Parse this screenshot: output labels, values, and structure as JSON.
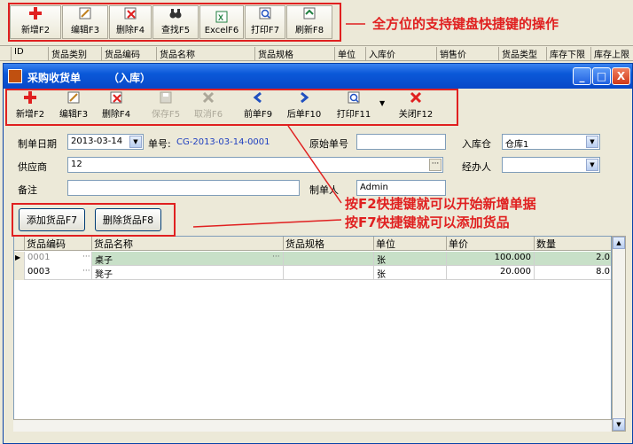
{
  "bg_toolbar": [
    {
      "label": "新增F2",
      "icon": "add-icon"
    },
    {
      "label": "编辑F3",
      "icon": "edit-icon"
    },
    {
      "label": "删除F4",
      "icon": "delete-icon"
    },
    {
      "label": "查找F5",
      "icon": "binoculars-icon"
    },
    {
      "label": "ExcelF6",
      "icon": "excel-icon"
    },
    {
      "label": "打印F7",
      "icon": "print-icon"
    },
    {
      "label": "刷新F8",
      "icon": "refresh-icon"
    }
  ],
  "annotations": {
    "top": "全方位的支持键盘快捷键的操作",
    "line1": "按F2快捷键就可以开始新增单据",
    "line2": "按F7快捷键就可以添加货品"
  },
  "bg_grid_headers": [
    "ID",
    "货品类别",
    "货品编码",
    "货品名称",
    "货品规格",
    "单位",
    "入库价",
    "销售价",
    "货品类型",
    "库存下限",
    "库存上限"
  ],
  "window": {
    "title": "采购收货单",
    "subtitle": "（入库）",
    "min": "_",
    "max": "□",
    "close": "X"
  },
  "toolbar": [
    {
      "label": "新增F2",
      "icon": "add-icon",
      "enabled": true
    },
    {
      "label": "编辑F3",
      "icon": "edit-icon",
      "enabled": true
    },
    {
      "label": "删除F4",
      "icon": "delete-icon",
      "enabled": true
    },
    {
      "label": "保存F5",
      "icon": "save-icon",
      "enabled": false
    },
    {
      "label": "取消F6",
      "icon": "cancel-icon",
      "enabled": false
    },
    {
      "label": "前单F9",
      "icon": "prev-icon",
      "enabled": true
    },
    {
      "label": "后单F10",
      "icon": "next-icon",
      "enabled": true
    },
    {
      "label": "打印F11",
      "icon": "print-icon",
      "enabled": true
    },
    {
      "label": "关闭F12",
      "icon": "close-icon",
      "enabled": true
    }
  ],
  "form": {
    "date_label": "制单日期",
    "date_value": "2013-03-14",
    "bill_label": "单号:",
    "bill_value": "CG-2013-03-14-0001",
    "orig_label": "原始单号",
    "orig_value": "",
    "warehouse_label": "入库仓",
    "warehouse_value": "仓库1",
    "supplier_label": "供应商",
    "supplier_value": "12",
    "handler_label": "经办人",
    "handler_value": "",
    "remark_label": "备注",
    "remark_value": "",
    "maker_label": "制单人",
    "maker_value": "Admin"
  },
  "buttons": {
    "add_goods": "添加货品F7",
    "delete_goods": "删除货品F8"
  },
  "grid": {
    "headers": [
      "货品编码",
      "货品名称",
      "货品规格",
      "单位",
      "单价",
      "数量"
    ],
    "rows": [
      {
        "code": "0001",
        "name": "桌子",
        "spec": "",
        "unit": "张",
        "price": "100.000",
        "qty": "2.0"
      },
      {
        "code": "0003",
        "name": "凳子",
        "spec": "",
        "unit": "张",
        "price": "20.000",
        "qty": "8.0"
      }
    ],
    "ellipsis": "···"
  }
}
